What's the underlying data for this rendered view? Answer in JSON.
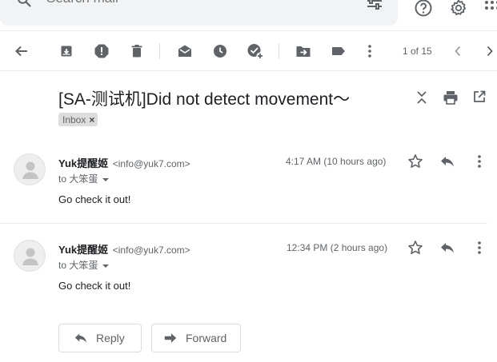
{
  "search": {
    "placeholder": "Search mail"
  },
  "toolbar": {
    "icons": [
      "back-arrow-icon",
      "archive-icon",
      "report-spam-icon",
      "delete-icon",
      "mark-unread-icon",
      "snooze-icon",
      "add-to-tasks-icon",
      "move-to-icon",
      "label-icon",
      "more-vert-icon"
    ],
    "pager_text": "1 of 15"
  },
  "thread": {
    "subject": "[SA-测试机]Did not detect movement～",
    "label": "Inbox",
    "label_remove": "×"
  },
  "messages": [
    {
      "sender_name": "Yuk提醒姬",
      "sender_email": "<info@yuk7.com>",
      "to": "to 大笨蛋",
      "time": "4:17 AM (10 hours ago)",
      "body": "Go check it out!"
    },
    {
      "sender_name": "Yuk提醒姬",
      "sender_email": "<info@yuk7.com>",
      "to": "to 大笨蛋",
      "time": "12:34 PM (2 hours ago)",
      "body": "Go check it out!"
    }
  ],
  "actions": {
    "reply_label": "Reply",
    "forward_label": "Forward"
  },
  "colors": {
    "icon": "#5f6368",
    "text": "#202124",
    "chip_bg": "#dddddd",
    "search_bg": "#f1f3f4"
  }
}
